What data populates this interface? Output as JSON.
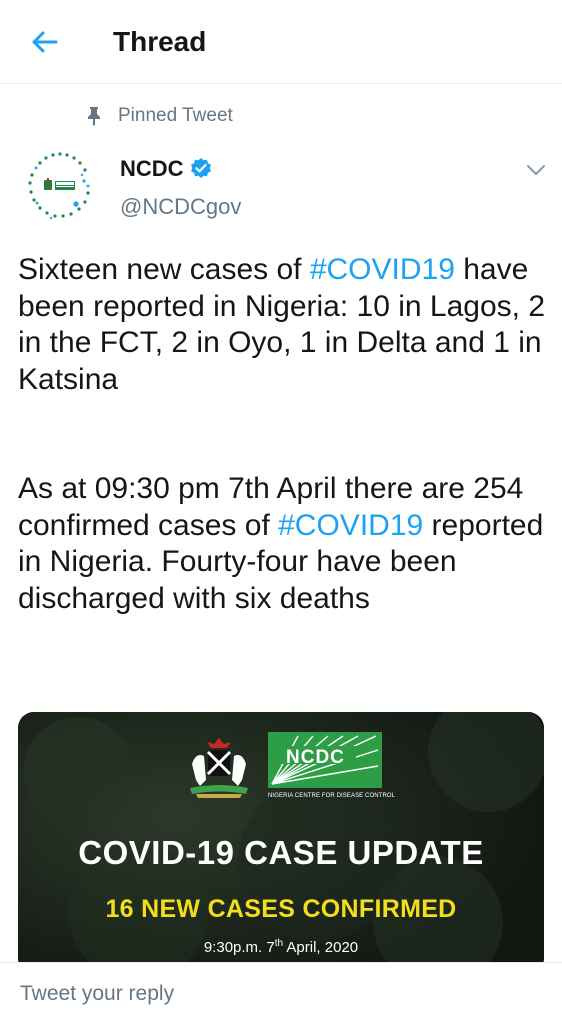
{
  "header": {
    "title": "Thread",
    "back_icon": "arrow-left-icon"
  },
  "colors": {
    "accent": "#1da1f2",
    "secondary_text": "#657786",
    "primary_text": "#14171a",
    "divider": "#e6ecf0",
    "media_headline_yellow": "#f3df19"
  },
  "tweet": {
    "pinned_label": "Pinned Tweet",
    "pin_icon": "pin-icon",
    "author": {
      "name": "NCDC",
      "handle": "@NCDCgov",
      "verified_icon": "verified-badge-icon"
    },
    "caret_icon": "chevron-down-icon",
    "paragraph1": {
      "lead": "Sixteen new cases of ",
      "hashtag": "#COVID19",
      "rest": " have been reported in Nigeria: 10 in Lagos, 2 in the FCT, 2 in Oyo, 1 in Delta and 1 in Katsina"
    },
    "paragraph2": {
      "lead": "As at 09:30 pm 7th April there are 254 confirmed cases of ",
      "hashtag": "#COVID19",
      "rest": " reported in Nigeria. Fourty-four have been discharged with six deaths"
    },
    "media": {
      "logo_text": "NCDC",
      "logo_caption": "NIGERIA CENTRE FOR DISEASE CONTROL",
      "headline": "COVID-19 CASE UPDATE",
      "subheadline": "16 NEW CASES CONFIRMED",
      "date_prefix": "9:30p.m. 7",
      "date_sup": "th",
      "date_suffix": " April, 2020"
    }
  },
  "reply": {
    "placeholder": "Tweet your reply"
  }
}
